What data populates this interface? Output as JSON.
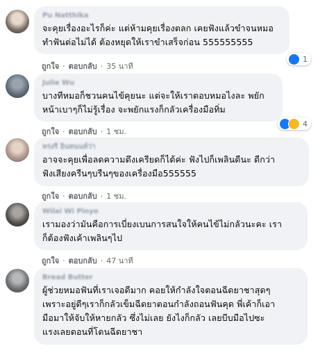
{
  "comments": [
    {
      "author": "Pu Natthika",
      "text": "จะคุยเรื่องอะไรก็ค่ะ แต่ห้ามคุยเรื่องตลก เคยฟังแล้วขำจนหมอ\nทำฟันต่อไม่ได้ ต้องหยุดให้เราขำเสร็จก่อน 555555555",
      "like": "ถูกใจ",
      "reply": "ตอบกลับ",
      "time": "35 นาที",
      "reaction_count": "1",
      "reactions": [
        "like-icon"
      ]
    },
    {
      "author": "Julie Wu",
      "text": "บางทีหมอก็ชวนคนไข้คุยนะ แต่จะให้เราตอบหมอไงละ พยัก\nหน้าเบาๆก็ไม่รู้เรื่อง จะพยักแรงก็กลัวเครื่องมือทิ่ม",
      "like": "ถูกใจ",
      "reply": "ตอบกลับ",
      "time": "1 ชม.",
      "reaction_count": "4",
      "reactions": [
        "like-icon",
        "haha-icon"
      ]
    },
    {
      "author": "ทรงรี อินทนนท์ว่า",
      "text": "อาจจะคุยเพื่อลดความตึงเครียดก็ได้ค่ะ ฟังไปก็เพลินดีนะ ดีกว่า\nฟังเสียงครืนๆบรืนๆของเครื่องมือ555555",
      "like": "ถูกใจ",
      "reply": "ตอบกลับ",
      "time": "1 ชม.",
      "reaction_count": "",
      "reactions": []
    },
    {
      "author": "Wilai Wi Pinyo",
      "text": "เรามองว่ามันคือการเบี่ยงเบนการสนใจให้คนไข้ไม่กลัวนะคะ เรา\nก็ต้องฟังเค้าเพลินๆไป",
      "like": "ถูกใจ",
      "reply": "ตอบกลับ",
      "time": "47 นาที",
      "reaction_count": "",
      "reactions": []
    },
    {
      "author": "Bread Butter",
      "text": "ผู้ช่วยหมอฟันที่เราเจอดีมาก คอยให้กำลังใจตอนฉีดยาชาสุดๆ\nเพราะอยู่ดีๆเราก็กลัวเข็มฉีดยาตอนกำลังถอนฟันคุด พี่เค้าก็เอา\nมือมาให้จับให้หายกลัว ซึ่งไม่เลย ยังไงก็กลัว เลยบีบมือไปซะ\nแรงเลยตอนที่โดนฉีดยาชา",
      "like": "ถูกใจ",
      "reply": "ตอบกลับ",
      "time": "",
      "reaction_count": "",
      "reactions": []
    }
  ],
  "colors": {
    "bubble": "#f0f2f5",
    "meta": "#65676b",
    "like_blue": "#1877f2",
    "haha_yellow": "#f7b928"
  }
}
